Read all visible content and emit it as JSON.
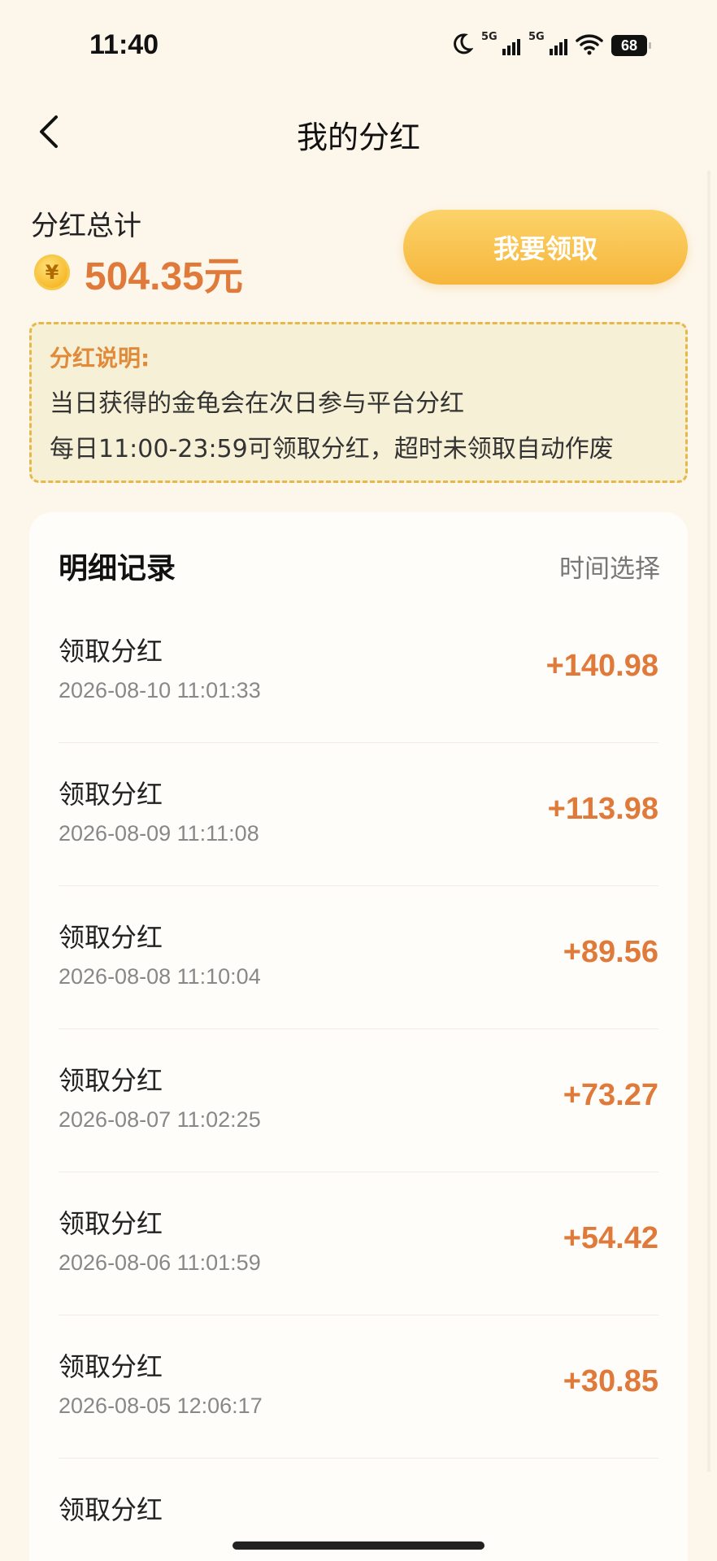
{
  "status_bar": {
    "time": "11:40",
    "signal1_tag": "5G",
    "signal2_tag": "5G",
    "battery": "68"
  },
  "nav": {
    "title": "我的分红"
  },
  "summary": {
    "label": "分红总计",
    "coin_symbol": "¥",
    "amount": "504.35元",
    "claim_button": "我要领取"
  },
  "notice": {
    "title": "分红说明:",
    "lines": [
      "当日获得的金龟会在次日参与平台分红",
      "每日11:00-23:59可领取分红，超时未领取自动作废"
    ]
  },
  "records": {
    "title": "明细记录",
    "filter_label": "时间选择",
    "items": [
      {
        "title": "领取分红",
        "date": "2026-08-10 11:01:33",
        "amount": "+140.98"
      },
      {
        "title": "领取分红",
        "date": "2026-08-09 11:11:08",
        "amount": "+113.98"
      },
      {
        "title": "领取分红",
        "date": "2026-08-08 11:10:04",
        "amount": "+89.56"
      },
      {
        "title": "领取分红",
        "date": "2026-08-07 11:02:25",
        "amount": "+73.27"
      },
      {
        "title": "领取分红",
        "date": "2026-08-06 11:01:59",
        "amount": "+54.42"
      },
      {
        "title": "领取分红",
        "date": "2026-08-05 12:06:17",
        "amount": "+30.85"
      },
      {
        "title": "领取分红",
        "date": "",
        "amount": ""
      }
    ]
  },
  "colors": {
    "accent": "#e07a3a",
    "button": "#f6b63b",
    "background": "#fdf6ea"
  }
}
